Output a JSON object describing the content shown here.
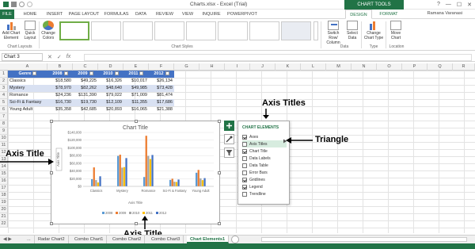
{
  "window": {
    "title": "Charts.xlsx - Excel (Trial)",
    "context_tab_group": "CHART TOOLS",
    "user": "Ramana Varanasi",
    "controls": [
      "?",
      "—",
      "☐",
      "✕"
    ]
  },
  "tabs": [
    "FILE",
    "HOME",
    "INSERT",
    "PAGE LAYOUT",
    "FORMULAS",
    "DATA",
    "REVIEW",
    "VIEW",
    "INQUIRE",
    "POWERPIVOT",
    "DESIGN",
    "FORMAT"
  ],
  "ribbon": {
    "add_chart_element": "Add Chart Element",
    "quick_layout": "Quick Layout",
    "change_colors": "Change Colors",
    "switch_row_col": "Switch Row/ Column",
    "select_data": "Select Data",
    "change_chart_type": "Change Chart Type",
    "move_chart": "Move Chart",
    "groups": {
      "chart_layouts": "Chart Layouts",
      "chart_styles": "Chart Styles",
      "data": "Data",
      "type": "Type",
      "location": "Location"
    }
  },
  "formula_bar": {
    "name_box": "Chart 3",
    "icons": [
      "✕",
      "✓",
      "fx"
    ]
  },
  "columns": [
    "A",
    "B",
    "C",
    "D",
    "E",
    "F",
    "G",
    "H",
    "I",
    "J",
    "K",
    "L",
    "M",
    "N",
    "O",
    "P",
    "Q",
    "R"
  ],
  "rows": [
    "1",
    "2",
    "3",
    "4",
    "5",
    "6",
    "7",
    "8",
    "9",
    "10",
    "11",
    "12",
    "13",
    "14",
    "15",
    "16",
    "17",
    "18",
    "19",
    "20",
    "21",
    "22"
  ],
  "table": {
    "headers": [
      "Genre",
      "2008",
      "2009",
      "2010",
      "2011",
      "2012"
    ],
    "rows": [
      [
        "Classics",
        "$18,580",
        "$49,225",
        "$16,326",
        "$10,017",
        "$26,134"
      ],
      [
        "Mystery",
        "$78,970",
        "$82,262",
        "$48,640",
        "$49,985",
        "$73,428"
      ],
      [
        "Romance",
        "$24,236",
        "$131,390",
        "$79,022",
        "$71,009",
        "$81,474"
      ],
      [
        "Sci-Fi & Fantasy",
        "$16,730",
        "$19,730",
        "$12,109",
        "$11,355",
        "$17,686"
      ],
      [
        "Young Adult",
        "$35,358",
        "$42,685",
        "$20,893",
        "$16,065",
        "$21,388"
      ]
    ]
  },
  "chart_data": {
    "type": "bar",
    "title": "Chart Title",
    "xlabel": "Axis Title",
    "ylabel": "Axis Title",
    "categories": [
      "Classics",
      "Mystery",
      "Romance",
      "Sci-Fi & Fantasy",
      "Young Adult"
    ],
    "series": [
      {
        "name": "2008",
        "color": "#5b9bd5",
        "values": [
          18580,
          78970,
          24236,
          16730,
          35358
        ]
      },
      {
        "name": "2009",
        "color": "#ed7d31",
        "values": [
          49225,
          82262,
          131390,
          19730,
          42685
        ]
      },
      {
        "name": "2010",
        "color": "#a5a5a5",
        "values": [
          16326,
          48640,
          79022,
          12109,
          20893
        ]
      },
      {
        "name": "2011",
        "color": "#ffc000",
        "values": [
          10017,
          49985,
          71009,
          11355,
          16065
        ]
      },
      {
        "name": "2012",
        "color": "#4472c4",
        "values": [
          26134,
          73428,
          81474,
          17686,
          21388
        ]
      }
    ],
    "yticks": [
      "$0",
      "$20,000",
      "$40,000",
      "$60,000",
      "$80,000",
      "$100,000",
      "$120,000",
      "$140,000"
    ],
    "ylim": [
      0,
      140000
    ],
    "grid": true,
    "legend_position": "bottom"
  },
  "chart_elements_panel": {
    "title": "CHART ELEMENTS",
    "items": [
      {
        "label": "Axes",
        "checked": true
      },
      {
        "label": "Axis Titles",
        "checked": false
      },
      {
        "label": "Chart Title",
        "checked": true
      },
      {
        "label": "Data Labels",
        "checked": false
      },
      {
        "label": "Data Table",
        "checked": false
      },
      {
        "label": "Error Bars",
        "checked": false
      },
      {
        "label": "Gridlines",
        "checked": true
      },
      {
        "label": "Legend",
        "checked": true
      },
      {
        "label": "Trendline",
        "checked": false
      }
    ]
  },
  "annotations": {
    "axis_titles_top": "Axis Titles",
    "triangle": "Triangle",
    "axis_title_left": "Axis Title",
    "axis_title_bottom": "Axis Title"
  },
  "sheet_tabs": [
    "...",
    "Radar Chart2",
    "Combo Chart1",
    "Combo Chart2",
    "Combo Chart3",
    "Chart Elements1"
  ],
  "colors": {
    "excel_green": "#217346",
    "table_header": "#4472c4",
    "table_band": "#d9e1f2"
  }
}
